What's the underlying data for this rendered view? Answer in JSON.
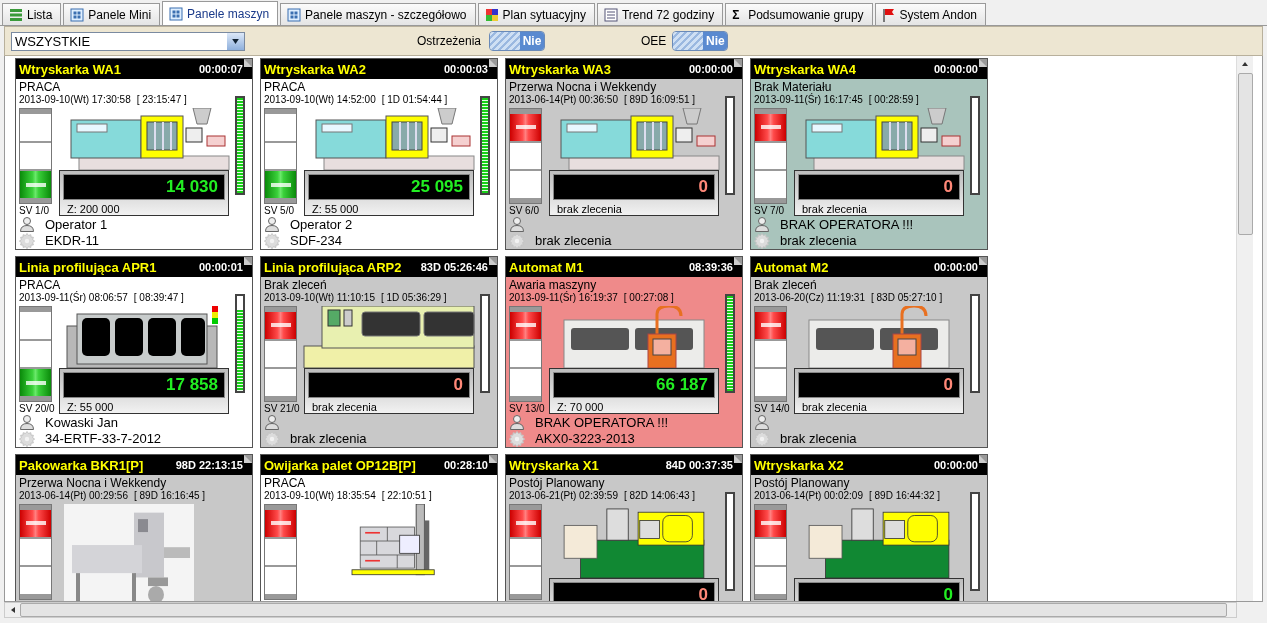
{
  "tabs": [
    {
      "label": "Lista",
      "kind": "list",
      "selected": false
    },
    {
      "label": "Panele Mini",
      "kind": "grid",
      "selected": false
    },
    {
      "label": "Panele maszyn",
      "kind": "grid",
      "selected": true
    },
    {
      "label": "Panele maszyn - szczegółowo",
      "kind": "grid",
      "selected": false
    },
    {
      "label": "Plan sytuacyjny",
      "kind": "plan",
      "selected": false
    },
    {
      "label": "Trend 72 godziny",
      "kind": "trend",
      "selected": false
    },
    {
      "label": "Podsumowanie grupy",
      "kind": "sigma",
      "glyph": "Σ",
      "selected": false
    },
    {
      "label": "System Andon",
      "kind": "flag",
      "selected": false
    }
  ],
  "toolbar": {
    "group_select": "WSZYSTKIE",
    "warnings": {
      "label": "Ostrzeżenia",
      "value": "Nie",
      "on": false
    },
    "oee": {
      "label": "OEE",
      "value": "Nie",
      "on": false
    }
  },
  "cards": [
    {
      "title": "Wtryskarka WA1",
      "timer": "00:00:07",
      "color": "#ffffff",
      "status": "PRACA",
      "timestamp": "2013-09-10(Wt) 17:30:58",
      "duration": "[ 23:15:47 ]",
      "running": true,
      "sv": "SV 1/0",
      "kind": "injection",
      "count": "14 030",
      "count_ok": true,
      "target": "Z:  200 000",
      "level": 1,
      "operator": "Operator 1",
      "order": "EKDR-11"
    },
    {
      "title": "Wtryskarka WA2",
      "timer": "00:00:03",
      "color": "#ffffff",
      "status": "PRACA",
      "timestamp": "2013-09-10(Wt) 14:52:00",
      "duration": "[ 1D 01:54:44 ]",
      "running": true,
      "sv": "SV 5/0",
      "kind": "injection",
      "count": "25 095",
      "count_ok": true,
      "target": "Z:  55 000",
      "level": 1,
      "operator": "Operator 2",
      "order": "SDF-234"
    },
    {
      "title": "Wtryskarka WA3",
      "timer": "00:00:00",
      "color": "#c8c8c8",
      "status": "Przerwa Nocna i Wekkendy",
      "timestamp": "2013-06-14(Pt) 00:36:50",
      "duration": "[ 89D 16:09:51 ]",
      "running": false,
      "sv": "SV 6/0",
      "kind": "injection",
      "count": "0",
      "count_ok": false,
      "target": "brak zlecenia",
      "level": 0,
      "order": "brak zlecenia"
    },
    {
      "title": "Wtryskarka WA4",
      "timer": "00:00:00",
      "color": "#a9c4bc",
      "status": "Brak Materiału",
      "timestamp": "2013-09-11(Śr) 16:17:45",
      "duration": "[ 00:28:59 ]",
      "running": false,
      "sv": "SV 7/0",
      "kind": "injection",
      "count": "0",
      "count_ok": false,
      "target": "brak zlecenia",
      "level": 0,
      "operator": "BRAK OPERATORA !!!",
      "order": "brak zlecenia"
    },
    {
      "title": "Linia profilująca APR1",
      "timer": "00:00:01",
      "color": "#ffffff",
      "status": "PRACA",
      "timestamp": "2013-09-11(Śr) 08:06:57",
      "duration": "[ 08:39:47 ]",
      "running": true,
      "sv": "SV 20/0",
      "kind": "profile",
      "count": "17 858",
      "count_ok": true,
      "target": "Z:  55 000",
      "level": 0.85,
      "operator": "Kowaski Jan",
      "order": "34-ERTF-33-7-2012"
    },
    {
      "title": "Linia profilująca ARP2",
      "timer": "83D 05:26:46",
      "color": "#c8c8c8",
      "status": "Brak zleceń",
      "timestamp": "2013-09-10(Wt) 11:10:15",
      "duration": "[ 1D 05:36:29 ]",
      "running": false,
      "sv": "SV 21/0",
      "kind": "profile_panels",
      "count": "0",
      "count_ok": false,
      "target": "brak zlecenia",
      "level": 0,
      "order": "brak zlecenia"
    },
    {
      "title": "Automat M1",
      "timer": "08:39:36",
      "color": "#ef8a8a",
      "status": "Awaria maszyny",
      "timestamp": "2013-09-11(Śr) 16:19:37",
      "duration": "[ 00:27:08 ]",
      "running": false,
      "sv": "SV 13/0",
      "kind": "automat",
      "count": "66 187",
      "count_ok": true,
      "target": "Z:  70 000",
      "level": 1,
      "operator": "BRAK OPERATORA !!!",
      "order": "AKX0-3223-2013"
    },
    {
      "title": "Automat M2",
      "timer": "00:00:00",
      "color": "#c8c8c8",
      "status": "Brak zleceń",
      "timestamp": "2013-06-20(Cz) 11:19:31",
      "duration": "[ 83D 05:27:10 ]",
      "running": false,
      "sv": "SV 14/0",
      "kind": "automat",
      "count": "0",
      "count_ok": false,
      "target": "brak zlecenia",
      "level": 0,
      "order": "brak zlecenia"
    },
    {
      "title": "Pakowarka BKR1[P]",
      "timer": "98D 22:13:15",
      "color": "#c8c8c8",
      "status": "Przerwa Nocna i Wekkendy",
      "timestamp": "2013-06-14(Pt) 00:29:56",
      "duration": "[ 89D 16:16:45 ]",
      "running": false
    },
    {
      "title": "Owijarka palet OP12B[P]",
      "timer": "00:28:10",
      "color": "#ffffff",
      "status": "PRACA",
      "timestamp": "2013-09-10(Wt) 18:35:54",
      "duration": "[ 22:10:51 ]",
      "running": false,
      "kind": "pallet"
    },
    {
      "title": "Wtryskarka X1",
      "timer": "84D 00:37:35",
      "color": "#c8c8c8",
      "status": "Postój Planowany",
      "timestamp": "2013-06-21(Pt) 02:39:59",
      "duration": "[ 82D 14:06:43 ]",
      "running": false,
      "kind": "injection_x",
      "count": "0",
      "count_ok": false,
      "level": 0
    },
    {
      "title": "Wtryskarka X2",
      "timer": "00:00:00",
      "color": "#c8c8c8",
      "status": "Postój Planowany",
      "timestamp": "2013-06-14(Pt) 00:02:09",
      "duration": "[ 89D 16:44:32 ]",
      "running": false,
      "kind": "injection_x",
      "count": "0",
      "count_ok": true,
      "level": 0
    }
  ]
}
